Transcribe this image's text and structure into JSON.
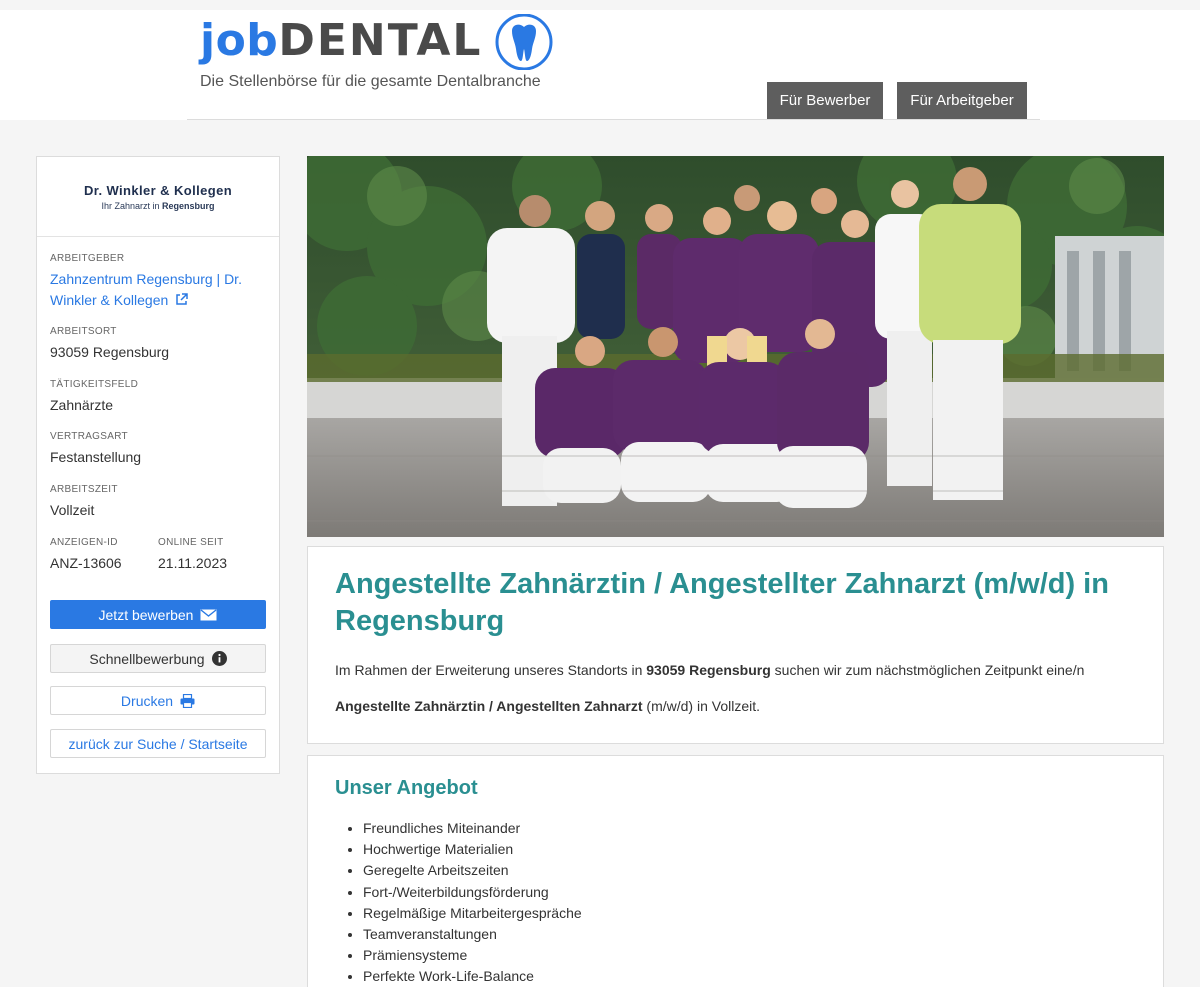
{
  "header": {
    "logo_job": "job",
    "logo_dental": "DENTAL",
    "tagline": "Die Stellenbörse für die gesamte Dentalbranche",
    "nav": [
      {
        "label": "Für Bewerber"
      },
      {
        "label": "Für Arbeitgeber"
      }
    ]
  },
  "sidebar": {
    "employer_logo": {
      "name": "Dr. Winkler & Kollegen",
      "sub_prefix": "Ihr Zahnarzt in",
      "sub_city": "Regensburg"
    },
    "employer_label": "ARBEITGEBER",
    "employer_value": "Zahnzentrum Regensburg | Dr. Winkler & Kollegen",
    "location_label": "ARBEITSORT",
    "location_value": "93059 Regensburg",
    "field_label": "TÄTIGKEITSFELD",
    "field_value": "Zahnärzte",
    "contract_label": "VERTRAGSART",
    "contract_value": "Festanstellung",
    "worktime_label": "ARBEITSZEIT",
    "worktime_value": "Vollzeit",
    "ad_id_label": "ANZEIGEN-ID",
    "ad_id_value": "ANZ-13606",
    "online_label": "ONLINE SEIT",
    "online_value": "21.11.2023",
    "buttons": {
      "apply": "Jetzt bewerben",
      "quick": "Schnellbewerbung",
      "print": "Drucken",
      "back": "zurück zur Suche / Startseite"
    }
  },
  "main": {
    "job_title": "Angestellte Zahnärztin / Angestellter Zahnarzt (m/w/d) in Regensburg",
    "intro_a": "Im Rahmen der Erweiterung unseres Standorts in ",
    "intro_bold": "93059 Regensburg",
    "intro_b": " suchen wir zum nächstmöglichen Zeitpunkt eine/n",
    "intro2_bold": "Angestellte Zahnärztin / Angestellten Zahnarzt",
    "intro2_rest": " (m/w/d) in Vollzeit.",
    "offer_title": "Unser Angebot",
    "offer_items": [
      "Freundliches Miteinander",
      "Hochwertige Materialien",
      "Geregelte Arbeitszeiten",
      "Fort-/Weiterbildungsförderung",
      "Regelmäßige Mitarbeitergespräche",
      "Teamveranstaltungen",
      "Prämiensysteme",
      "Perfekte Work-Life-Balance"
    ]
  },
  "colors": {
    "brand_blue": "#2a79e3",
    "heading_teal": "#2a8f91",
    "nav_gray": "#5e5e5e"
  },
  "icons": [
    "tooth-icon",
    "external-link-icon",
    "envelope-icon",
    "info-icon",
    "printer-icon"
  ]
}
